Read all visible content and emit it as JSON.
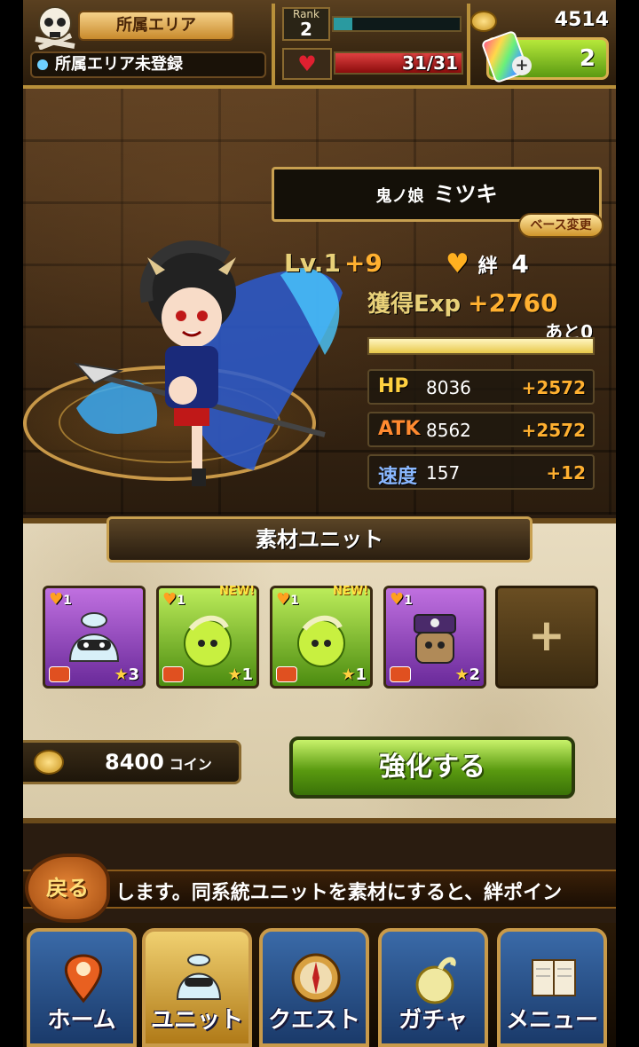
{
  "header": {
    "area_label": "所属エリア",
    "area_value": "所属エリア未登録",
    "rank_label": "Rank",
    "rank_value": "2",
    "rank_progress": 0.15,
    "stamina_text": "31/31",
    "stamina_progress": 1.0,
    "coins": "4514",
    "gems": "2"
  },
  "unit": {
    "title_prefix": "鬼ノ娘",
    "name": "ミツキ",
    "base_change_label": "ベース変更",
    "level_label": "Lv.",
    "level": "1",
    "level_gain": "+9",
    "bond_label": "絆",
    "bond_value": "4",
    "exp_label": "獲得Exp",
    "exp_value": "+2760",
    "remaining_label": "あと0",
    "exp_progress": 1.0,
    "stats": [
      {
        "key": "HP",
        "value": "8036",
        "bonus": "+2572",
        "color": "#ffd040"
      },
      {
        "key": "ATK",
        "value": "8562",
        "bonus": "+2572",
        "color": "#ff8a30"
      },
      {
        "key": "速度",
        "value": "157",
        "bonus": "+12",
        "color": "#8ab8ff"
      }
    ]
  },
  "materials": {
    "title": "素材ユニット",
    "slots": [
      {
        "bond": "1",
        "rarity": "3",
        "theme": "purple",
        "is_new": false
      },
      {
        "bond": "1",
        "rarity": "1",
        "theme": "green",
        "is_new": true
      },
      {
        "bond": "1",
        "rarity": "1",
        "theme": "green",
        "is_new": true
      },
      {
        "bond": "1",
        "rarity": "2",
        "theme": "purple",
        "is_new": false
      }
    ],
    "new_label": "NEW!",
    "empty_plus": "+",
    "cost": "8400",
    "cost_unit": "コイン",
    "enhance_label": "強化する"
  },
  "ticker": {
    "text": "します。同系統ユニットを素材にすると、絆ポイン",
    "back_label": "戻る"
  },
  "nav": {
    "items": [
      {
        "label": "ホーム",
        "icon": "map-pin-icon"
      },
      {
        "label": "ユニット",
        "icon": "pot-ghost-icon"
      },
      {
        "label": "クエスト",
        "icon": "compass-icon"
      },
      {
        "label": "ガチャ",
        "icon": "flame-orb-icon"
      },
      {
        "label": "メニュー",
        "icon": "book-icon"
      }
    ],
    "active_index": 1
  }
}
